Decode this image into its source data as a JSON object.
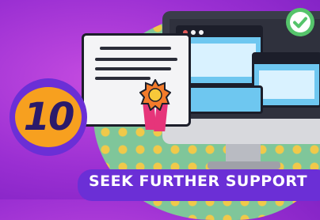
{
  "badge": {
    "number": "10"
  },
  "title": {
    "text": "SEEK FURTHER SUPPORT"
  },
  "icons": {
    "monitor": "monitor-icon",
    "check": "check-icon",
    "certificate": "certificate-icon",
    "award": "award-ribbon-icon"
  },
  "colors": {
    "background": "#9a2fd2",
    "badge_ring": "#6b2fd6",
    "badge_fill": "#f7a01f",
    "banner": "#6b2fd6",
    "check": "#55c46b",
    "ribbon": "#e6357a"
  }
}
